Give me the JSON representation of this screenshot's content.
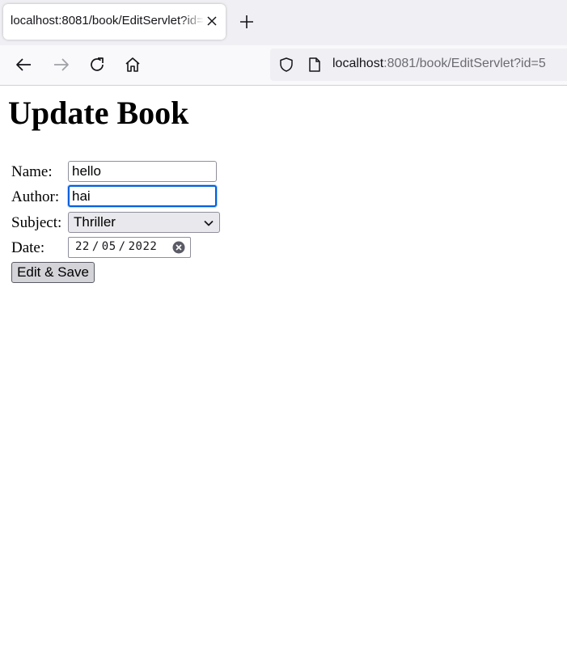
{
  "browser": {
    "tab": {
      "title": "localhost:8081/book/EditServlet?id=5"
    },
    "url": {
      "host": "localhost",
      "rest": ":8081/book/EditServlet?id=5"
    }
  },
  "page": {
    "heading": "Update Book",
    "form": {
      "name": {
        "label": "Name:",
        "value": "hello"
      },
      "author": {
        "label": "Author:",
        "value": "hai"
      },
      "subject": {
        "label": "Subject:",
        "selected": "Thriller"
      },
      "date": {
        "label": "Date:",
        "day": "22",
        "month": "05",
        "year": "2022",
        "separator": "/"
      },
      "submit_label": "Edit & Save"
    }
  },
  "colors": {
    "focus_ring": "#0060df",
    "chrome_background": "#f0f0f4",
    "button_background": "#d3d3d8"
  }
}
